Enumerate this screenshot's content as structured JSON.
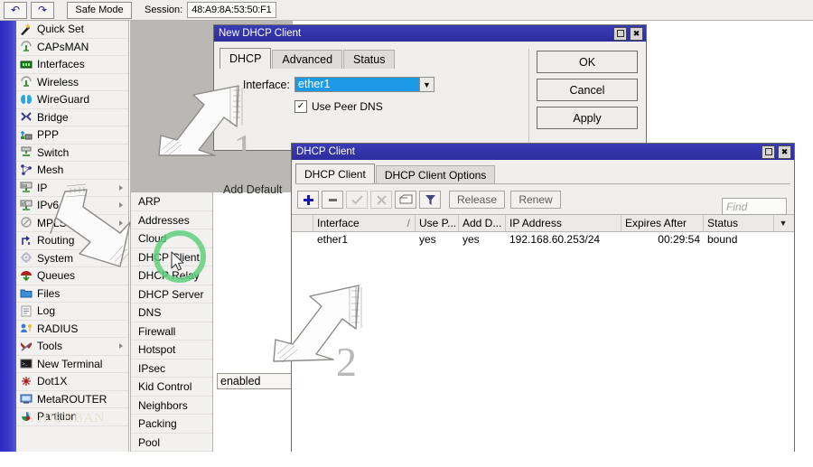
{
  "toolbar": {
    "undo_icon": "undo-arrow-icon",
    "redo_icon": "redo-arrow-icon",
    "safe_mode_label": "Safe Mode",
    "session_label": "Session:",
    "session_value": "48:A9:8A:53:50:F1"
  },
  "sidebar": {
    "items": [
      {
        "label": "Quick Set",
        "icon": "wand-icon",
        "submenu": false
      },
      {
        "label": "CAPsMAN",
        "icon": "antenna-icon",
        "submenu": false
      },
      {
        "label": "Interfaces",
        "icon": "nic-card-icon",
        "submenu": false
      },
      {
        "label": "Wireless",
        "icon": "antenna-icon",
        "submenu": false
      },
      {
        "label": "WireGuard",
        "icon": "wireguard-icon",
        "submenu": false
      },
      {
        "label": "Bridge",
        "icon": "bridge-icon",
        "submenu": false
      },
      {
        "label": "PPP",
        "icon": "ppp-icon",
        "submenu": false
      },
      {
        "label": "Switch",
        "icon": "switch-icon",
        "submenu": false
      },
      {
        "label": "Mesh",
        "icon": "mesh-icon",
        "submenu": false
      },
      {
        "label": "IP",
        "icon": "ip-icon",
        "submenu": true
      },
      {
        "label": "IPv6",
        "icon": "ipv6-icon",
        "submenu": true
      },
      {
        "label": "MPLS",
        "icon": "mpls-icon",
        "submenu": true
      },
      {
        "label": "Routing",
        "icon": "routing-icon",
        "submenu": true
      },
      {
        "label": "System",
        "icon": "gear-icon",
        "submenu": true
      },
      {
        "label": "Queues",
        "icon": "queues-icon",
        "submenu": false
      },
      {
        "label": "Files",
        "icon": "folder-icon",
        "submenu": false
      },
      {
        "label": "Log",
        "icon": "log-icon",
        "submenu": false
      },
      {
        "label": "RADIUS",
        "icon": "radius-icon",
        "submenu": false
      },
      {
        "label": "Tools",
        "icon": "tools-icon",
        "submenu": true
      },
      {
        "label": "New Terminal",
        "icon": "terminal-icon",
        "submenu": false
      },
      {
        "label": "Dot1X",
        "icon": "dot1x-icon",
        "submenu": false
      },
      {
        "label": "MetaROUTER",
        "icon": "metarouter-icon",
        "submenu": false
      },
      {
        "label": "Partition",
        "icon": "partition-icon",
        "submenu": false
      }
    ]
  },
  "ip_submenu": {
    "items": [
      {
        "label": "ARP"
      },
      {
        "label": "Addresses"
      },
      {
        "label": "Cloud"
      },
      {
        "label": "DHCP Client"
      },
      {
        "label": "DHCP Relay"
      },
      {
        "label": "DHCP Server"
      },
      {
        "label": "DNS"
      },
      {
        "label": "Firewall"
      },
      {
        "label": "Hotspot"
      },
      {
        "label": "IPsec"
      },
      {
        "label": "Kid Control"
      },
      {
        "label": "Neighbors"
      },
      {
        "label": "Packing"
      },
      {
        "label": "Pool"
      }
    ],
    "highlighted": "DHCP Client",
    "highlight_color": "#5fd07a"
  },
  "new_dhcp_client_window": {
    "title": "New DHCP Client",
    "maximize_icon": "maximize-icon",
    "close_icon": "close-icon",
    "tabs": [
      {
        "label": "DHCP",
        "active": true
      },
      {
        "label": "Advanced",
        "active": false
      },
      {
        "label": "Status",
        "active": false
      }
    ],
    "interface_label": "Interface:",
    "interface_value": "ether1",
    "interface_dropdown_icon": "chevron-down-icon",
    "interface_highlight_color": "#1c9ae8",
    "use_peer_dns_label": "Use Peer DNS",
    "use_peer_dns_checked": true,
    "add_default_label": "Add Default",
    "enabled_value": "enabled",
    "buttons": [
      {
        "label": "OK"
      },
      {
        "label": "Cancel"
      },
      {
        "label": "Apply"
      }
    ]
  },
  "dhcp_client_window": {
    "title": "DHCP Client",
    "maximize_icon": "maximize-icon",
    "close_icon": "close-icon",
    "tabs": [
      {
        "label": "DHCP Client",
        "active": true
      },
      {
        "label": "DHCP Client Options",
        "active": false
      }
    ],
    "toolbar": {
      "add_icon": "plus-icon",
      "remove_icon": "minus-icon",
      "enable_icon": "check-icon",
      "disable_icon": "cross-icon",
      "comment_icon": "comment-icon",
      "filter_icon": "funnel-icon",
      "release_label": "Release",
      "renew_label": "Renew",
      "find_placeholder": "Find"
    },
    "columns": [
      {
        "label": "Interface",
        "sort_marker": "/"
      },
      {
        "label": "Use P..."
      },
      {
        "label": "Add D..."
      },
      {
        "label": "IP Address"
      },
      {
        "label": "Expires After"
      },
      {
        "label": "Status"
      }
    ],
    "column_menu_icon": "chevron-down-icon",
    "rows": [
      {
        "interface": "ether1",
        "use_peer_dns": "yes",
        "add_default_route": "yes",
        "ip_address": "192.168.60.253/24",
        "expires_after": "00:29:54",
        "status": "bound"
      }
    ]
  },
  "annotations": {
    "step_one": "1",
    "step_two": "2",
    "arrow_icon": "hand-drawn-arrow-icon",
    "watermark": "VIDEHBAN"
  }
}
